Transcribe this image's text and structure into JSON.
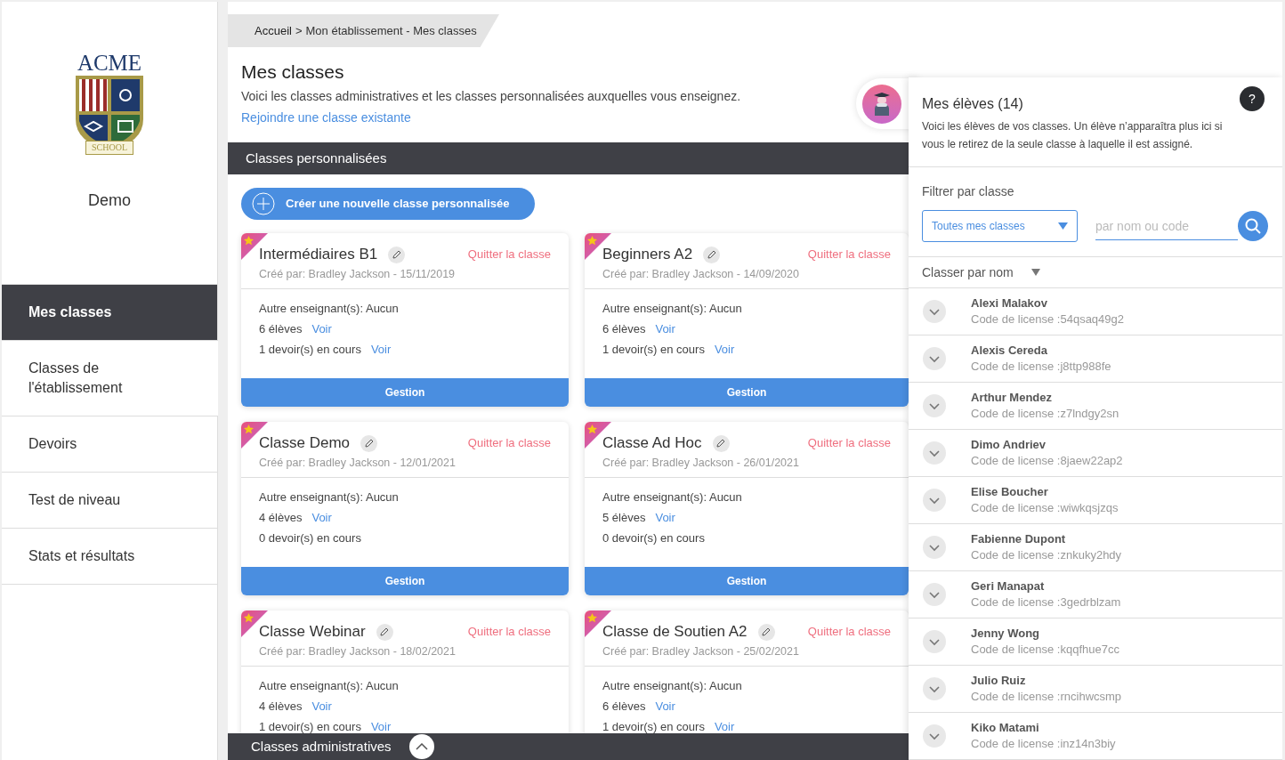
{
  "logo": {
    "top": "ACME",
    "ribbon": "SCHOOL"
  },
  "school_name": "Demo",
  "sidebar": {
    "items": [
      {
        "label": "Mes classes",
        "selected": true
      },
      {
        "label": "Classes de l'établissement",
        "selected": false
      },
      {
        "label": "Devoirs",
        "selected": false
      },
      {
        "label": "Test de niveau",
        "selected": false
      },
      {
        "label": "Stats et résultats",
        "selected": false
      }
    ]
  },
  "breadcrumb": {
    "home": "Accueil",
    "separator": ">",
    "path": "Mon établissement - Mes classes"
  },
  "page": {
    "title": "Mes classes",
    "description": "Voici les classes administratives et les classes personnalisées auxquelles vous enseignez.",
    "join_link": "Rejoindre une classe existante"
  },
  "custom_section": {
    "title": "Classes personnalisées",
    "create_button": "Créer une nouvelle classe personnalisée"
  },
  "classes": [
    {
      "name": "Intermédiaires B1",
      "favorite": true,
      "leave": "Quitter la classe",
      "created": "Créé par: Bradley Jackson - 15/11/2019",
      "teachers": "Autre enseignant(s): Aucun",
      "students": "6 élèves",
      "students_link": "Voir",
      "assignments": "1 devoir(s) en cours",
      "assignments_link": "Voir",
      "manage": "Gestion"
    },
    {
      "name": "Beginners A2",
      "favorite": true,
      "leave": "Quitter la classe",
      "created": "Créé par: Bradley Jackson - 14/09/2020",
      "teachers": "Autre enseignant(s): Aucun",
      "students": "6 élèves",
      "students_link": "Voir",
      "assignments": "1 devoir(s) en cours",
      "assignments_link": "Voir",
      "manage": "Gestion"
    },
    {
      "name": "Classe Demo",
      "favorite": true,
      "leave": "Quitter la classe",
      "created": "Créé par: Bradley Jackson - 12/01/2021",
      "teachers": "Autre enseignant(s): Aucun",
      "students": "4 élèves",
      "students_link": "Voir",
      "assignments": "0 devoir(s) en cours",
      "manage": "Gestion"
    },
    {
      "name": "Classe Ad Hoc",
      "favorite": true,
      "leave": "Quitter la classe",
      "created": "Créé par: Bradley Jackson - 26/01/2021",
      "teachers": "Autre enseignant(s): Aucun",
      "students": "5 élèves",
      "students_link": "Voir",
      "assignments": "0 devoir(s) en cours",
      "manage": "Gestion"
    },
    {
      "name": "Classe Webinar",
      "favorite": true,
      "leave": "Quitter la classe",
      "created": "Créé par: Bradley Jackson - 18/02/2021",
      "teachers": "Autre enseignant(s): Aucun",
      "students": "4 élèves",
      "students_link": "Voir",
      "assignments": "1 devoir(s) en cours",
      "assignments_link": "Voir"
    },
    {
      "name": "Classe de Soutien A2",
      "favorite": true,
      "leave": "Quitter la classe",
      "created": "Créé par: Bradley Jackson - 25/02/2021",
      "teachers": "Autre enseignant(s): Aucun",
      "students": "6 élèves",
      "students_link": "Voir",
      "assignments": "1 devoir(s) en cours",
      "assignments_link": "Voir"
    }
  ],
  "admin_section": {
    "title": "Classes administratives",
    "expanded": false
  },
  "students_panel": {
    "title": "Mes élèves (14)",
    "help": "?",
    "description": "Voici les élèves de vos classes. Un élève n’apparaîtra plus ici si vous le retirez de la seule classe à laquelle il est assigné.",
    "filter_label": "Filtrer par classe",
    "filter_value": "Toutes mes classes",
    "search_placeholder": "par nom ou code",
    "sort_label": "Classer par nom",
    "students": [
      {
        "name": "Alexi Malakov",
        "code": "Code de license :54qsaq49g2"
      },
      {
        "name": "Alexis Cereda",
        "code": "Code de license :j8ttp988fe"
      },
      {
        "name": "Arthur Mendez",
        "code": "Code de license :z7lndgy2sn"
      },
      {
        "name": "Dimo Andriev",
        "code": "Code de license :8jaew22ap2"
      },
      {
        "name": "Elise Boucher",
        "code": "Code de license :wiwkqsjzqs"
      },
      {
        "name": "Fabienne Dupont",
        "code": "Code de license :znkuky2hdy"
      },
      {
        "name": "Geri Manapat",
        "code": "Code de license :3gedrblzam"
      },
      {
        "name": "Jenny Wong",
        "code": "Code de license :kqqfhue7cc"
      },
      {
        "name": "Julio Ruiz",
        "code": "Code de license :rncihwcsmp"
      },
      {
        "name": "Kiko Matami",
        "code": "Code de license :inz14n3biy"
      }
    ]
  }
}
